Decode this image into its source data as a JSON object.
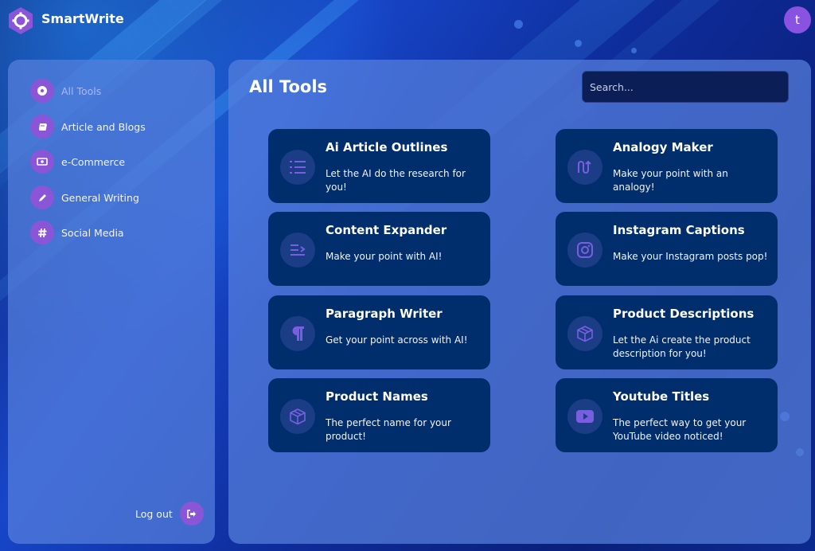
{
  "header": {
    "brand": "SmartWrite",
    "avatar_initial": "t"
  },
  "sidebar": {
    "items": [
      {
        "label": "All Tools",
        "icon": "soccer-ball-icon",
        "active": true
      },
      {
        "label": "Article and Blogs",
        "icon": "book-icon",
        "active": false
      },
      {
        "label": "e-Commerce",
        "icon": "money-bill-icon",
        "active": false
      },
      {
        "label": "General Writing",
        "icon": "pencil-icon",
        "active": false
      },
      {
        "label": "Social Media",
        "icon": "hashtag-icon",
        "active": false
      }
    ],
    "logout_label": "Log out",
    "logout_icon": "sign-out-icon"
  },
  "main": {
    "title": "All Tools",
    "search_placeholder": "Search..."
  },
  "cards": [
    {
      "title": "Ai Article Outlines",
      "desc": "Let the AI do the research for you!",
      "icon": "list-icon"
    },
    {
      "title": "Analogy Maker",
      "desc": "Make your point with an analogy!",
      "icon": "route-icon"
    },
    {
      "title": "Content Expander",
      "desc": "Make your point with AI!",
      "icon": "expand-text-icon"
    },
    {
      "title": "Instagram Captions",
      "desc": "Make your Instagram posts pop!",
      "icon": "instagram-icon"
    },
    {
      "title": "Paragraph Writer",
      "desc": "Get your point across with AI!",
      "icon": "paragraph-icon"
    },
    {
      "title": "Product Descriptions",
      "desc": "Let the Ai create the product description for you!",
      "icon": "box-icon"
    },
    {
      "title": "Product Names",
      "desc": "The perfect name for your product!",
      "icon": "box-icon"
    },
    {
      "title": "Youtube Titles",
      "desc": "The perfect way to get your YouTube video noticed!",
      "icon": "youtube-icon"
    }
  ],
  "colors": {
    "accent_purple": "#8a55d6",
    "card_bg": "#002d6b",
    "card_icon_bg": "#1b3d86",
    "panel_bg": "#5680dc"
  }
}
